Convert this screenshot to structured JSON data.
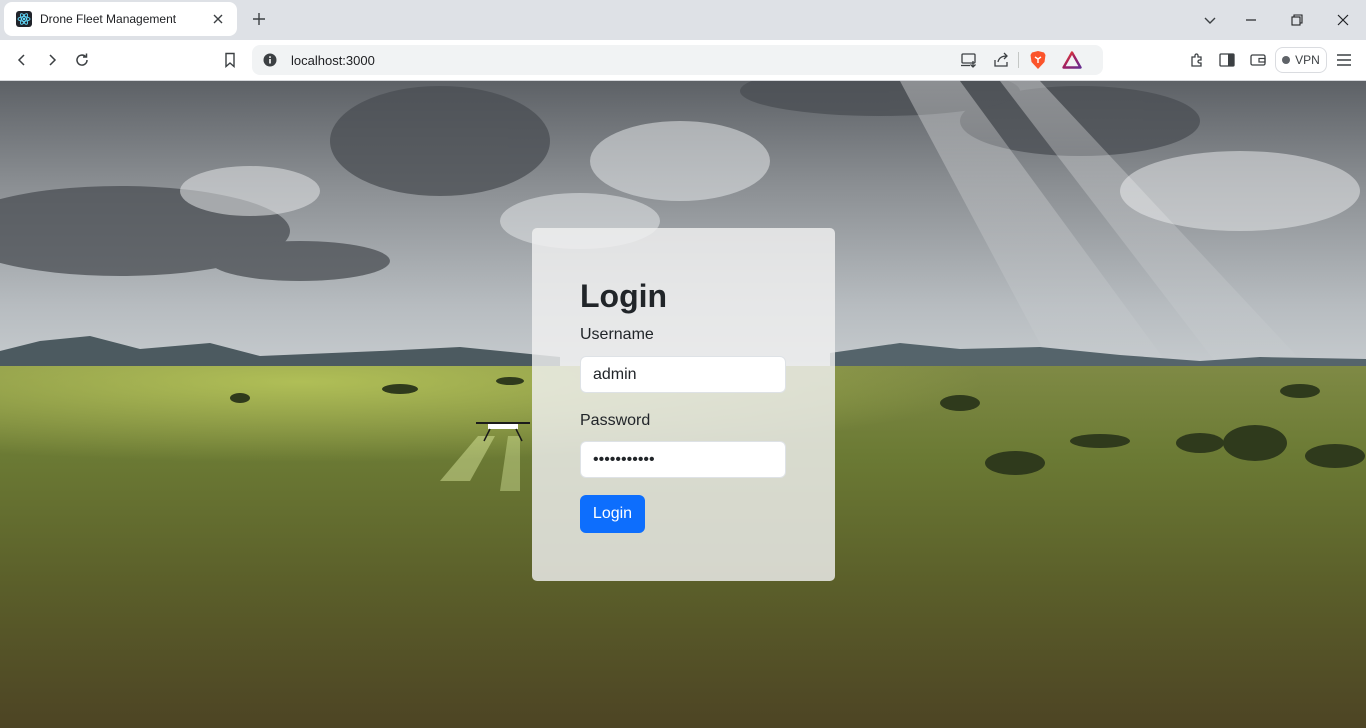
{
  "browser": {
    "tab": {
      "title": "Drone Fleet Management",
      "favicon": "react-atom-icon"
    },
    "new_tab_label": "+",
    "window_controls": [
      "minimize-icon",
      "restore-icon",
      "close-icon"
    ],
    "address_bar": {
      "url": "localhost:3000"
    },
    "vpn_label": "VPN",
    "colors": {
      "brave_orange": "#fb542b",
      "accent_blue": "#0d6efd"
    }
  },
  "login": {
    "heading": "Login",
    "username_label": "Username",
    "username_value": "admin",
    "password_label": "Password",
    "password_value": "•••••••••••",
    "submit_label": "Login"
  }
}
